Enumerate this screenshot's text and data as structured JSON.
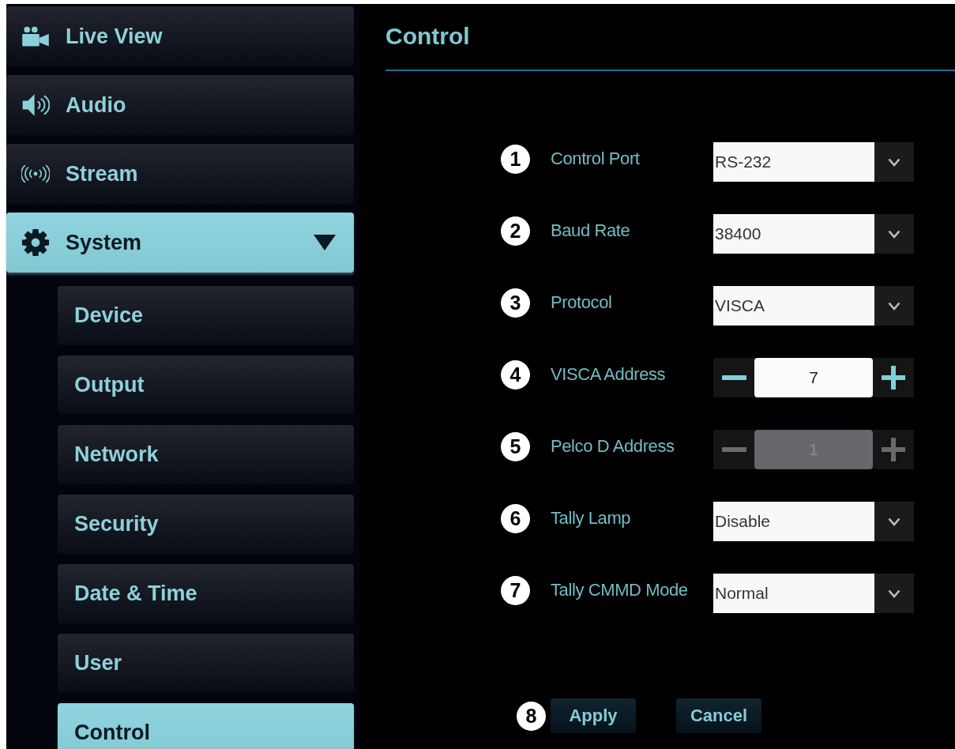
{
  "sidebar": {
    "items": [
      {
        "label": "Live View",
        "selected": false
      },
      {
        "label": "Audio",
        "selected": false
      },
      {
        "label": "Stream",
        "selected": false
      },
      {
        "label": "System",
        "selected": true,
        "expanded": true,
        "children": [
          {
            "label": "Device",
            "selected": false
          },
          {
            "label": "Output",
            "selected": false
          },
          {
            "label": "Network",
            "selected": false
          },
          {
            "label": "Security",
            "selected": false
          },
          {
            "label": "Date & Time",
            "selected": false
          },
          {
            "label": "User",
            "selected": false
          },
          {
            "label": "Control",
            "selected": true
          }
        ]
      }
    ]
  },
  "page": {
    "title": "Control"
  },
  "form": {
    "fields": [
      {
        "number": "1",
        "label": "Control Port",
        "kind": "select",
        "value": "RS-232"
      },
      {
        "number": "2",
        "label": "Baud Rate",
        "kind": "select",
        "value": "38400"
      },
      {
        "number": "3",
        "label": "Protocol",
        "kind": "select",
        "value": "VISCA"
      },
      {
        "number": "4",
        "label": "VISCA Address",
        "kind": "stepper",
        "value": "7",
        "disabled": false
      },
      {
        "number": "5",
        "label": "Pelco D Address",
        "kind": "stepper",
        "value": "1",
        "disabled": true
      },
      {
        "number": "6",
        "label": "Tally Lamp",
        "kind": "select",
        "value": "Disable"
      },
      {
        "number": "7",
        "label": "Tally CMMD Mode",
        "kind": "select",
        "value": "Normal"
      }
    ]
  },
  "actions": {
    "number": "8",
    "buttons": [
      "Apply",
      "Cancel"
    ]
  }
}
